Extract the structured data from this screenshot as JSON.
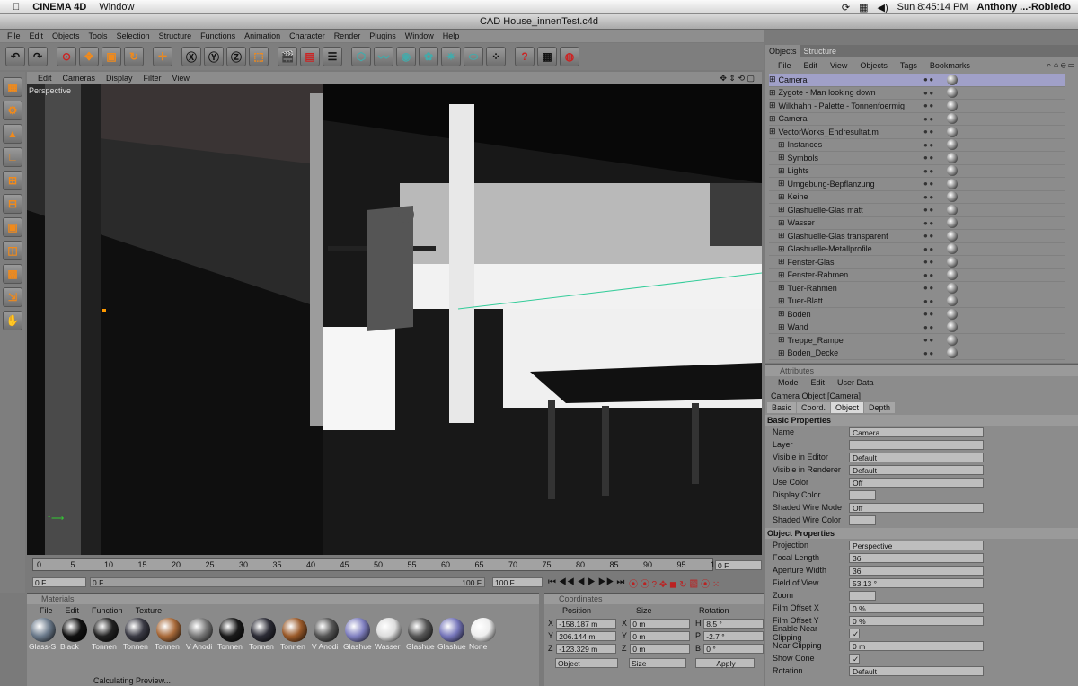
{
  "mac": {
    "app": "CINEMA 4D",
    "window": "Window",
    "clock": "Sun 8:45:14 PM",
    "user": "Anthony ...-Robledo"
  },
  "doc": {
    "title": "CAD House_innenTest.c4d"
  },
  "menu": [
    "File",
    "Edit",
    "Objects",
    "Tools",
    "Selection",
    "Structure",
    "Functions",
    "Animation",
    "Character",
    "Render",
    "Plugins",
    "Window",
    "Help"
  ],
  "viewport": {
    "menu": [
      "Edit",
      "Cameras",
      "Display",
      "Filter",
      "View"
    ],
    "label": "Perspective"
  },
  "timeline": {
    "ticks": [
      "0",
      "5",
      "10",
      "15",
      "20",
      "25",
      "30",
      "35",
      "40",
      "45",
      "50",
      "55",
      "60",
      "65",
      "70",
      "75",
      "80",
      "85",
      "90",
      "95",
      "100"
    ],
    "cur_frame": "0 F",
    "start": "0 F",
    "min": "0 F",
    "max": "100 F",
    "end": "100 F"
  },
  "materials": {
    "header": "Materials",
    "menu": [
      "File",
      "Edit",
      "Function",
      "Texture"
    ],
    "status": "Calculating Preview...",
    "items": [
      {
        "name": "Glass-S",
        "color": "#6c7b8c"
      },
      {
        "name": "Black",
        "color": "#111"
      },
      {
        "name": "Tonnen",
        "color": "#222"
      },
      {
        "name": "Tonnen",
        "color": "#3a3a44"
      },
      {
        "name": "Tonnen",
        "color": "#a86a3a"
      },
      {
        "name": "V Anodi",
        "color": "#777"
      },
      {
        "name": "Tonnen",
        "color": "#1a1a1a"
      },
      {
        "name": "Tonnen",
        "color": "#2c2c36"
      },
      {
        "name": "Tonnen",
        "color": "#9a5a2a"
      },
      {
        "name": "V Anodi",
        "color": "#555"
      },
      {
        "name": "Glashue",
        "color": "#8080c0"
      },
      {
        "name": "Wasser",
        "color": "#ddd"
      },
      {
        "name": "Glashue",
        "color": "#555"
      },
      {
        "name": "Glashue",
        "color": "#7777bb"
      },
      {
        "name": "None",
        "color": "#eee"
      }
    ]
  },
  "coords": {
    "header": "Coordinates",
    "cols": [
      "Position",
      "Size",
      "Rotation"
    ],
    "rows": [
      {
        "a": "X",
        "p": "-158.187 m",
        "b": "X",
        "s": "0 m",
        "c": "H",
        "r": "8.5 °"
      },
      {
        "a": "Y",
        "p": "206.144 m",
        "b": "Y",
        "s": "0 m",
        "c": "P",
        "r": "-2.7 °"
      },
      {
        "a": "Z",
        "p": "-123.329 m",
        "b": "Z",
        "s": "0 m",
        "c": "B",
        "r": "0 °"
      }
    ],
    "mode": "Object",
    "size": "Size",
    "apply": "Apply"
  },
  "objects": {
    "tabs": [
      "Objects",
      "Structure"
    ],
    "menu": [
      "File",
      "Edit",
      "View",
      "Objects",
      "Tags",
      "Bookmarks"
    ],
    "items": [
      {
        "name": "Camera",
        "indent": 0,
        "sel": true
      },
      {
        "name": "Zygote - Man looking down",
        "indent": 0
      },
      {
        "name": "Wilkhahn - Palette - Tonnenfoermig",
        "indent": 0
      },
      {
        "name": "Camera",
        "indent": 0
      },
      {
        "name": "VectorWorks_Endresultat.m",
        "indent": 0
      },
      {
        "name": "Instances",
        "indent": 1
      },
      {
        "name": "Symbols",
        "indent": 1
      },
      {
        "name": "Lights",
        "indent": 1
      },
      {
        "name": "Umgebung-Bepflanzung",
        "indent": 1
      },
      {
        "name": "Keine",
        "indent": 1
      },
      {
        "name": "Glashuelle-Glas matt",
        "indent": 1
      },
      {
        "name": "Wasser",
        "indent": 1
      },
      {
        "name": "Glashuelle-Glas transparent",
        "indent": 1
      },
      {
        "name": "Glashuelle-Metallprofile",
        "indent": 1
      },
      {
        "name": "Fenster-Glas",
        "indent": 1
      },
      {
        "name": "Fenster-Rahmen",
        "indent": 1
      },
      {
        "name": "Tuer-Rahmen",
        "indent": 1
      },
      {
        "name": "Tuer-Blatt",
        "indent": 1
      },
      {
        "name": "Boden",
        "indent": 1
      },
      {
        "name": "Wand",
        "indent": 1
      },
      {
        "name": "Treppe_Rampe",
        "indent": 1
      },
      {
        "name": "Boden_Decke",
        "indent": 1
      }
    ]
  },
  "attributes": {
    "header": "Attributes",
    "menu": [
      "Mode",
      "Edit",
      "User Data"
    ],
    "object": "Camera Object [Camera]",
    "tabs": [
      "Basic",
      "Coord.",
      "Object",
      "Depth"
    ],
    "basic_head": "Basic Properties",
    "basic": [
      {
        "l": "Name",
        "v": "Camera"
      },
      {
        "l": "Layer",
        "v": ""
      },
      {
        "l": "Visible in Editor",
        "v": "Default"
      },
      {
        "l": "Visible in Renderer",
        "v": "Default"
      },
      {
        "l": "Use Color",
        "v": "Off"
      },
      {
        "l": "Display Color",
        "v": ""
      },
      {
        "l": "Shaded Wire Mode",
        "v": "Off"
      },
      {
        "l": "Shaded Wire Color",
        "v": ""
      }
    ],
    "obj_head": "Object Properties",
    "obj": [
      {
        "l": "Projection",
        "v": "Perspective"
      },
      {
        "l": "Focal Length",
        "v": "36"
      },
      {
        "l": "Aperture Width",
        "v": "36"
      },
      {
        "l": "Field of View",
        "v": "53.13 °"
      },
      {
        "l": "Zoom",
        "v": ""
      },
      {
        "l": "Film Offset X",
        "v": "0 %"
      },
      {
        "l": "Film Offset Y",
        "v": "0 %"
      },
      {
        "l": "Enable Near Clipping",
        "v": "✓"
      },
      {
        "l": "Near Clipping",
        "v": "0 m"
      },
      {
        "l": "Show Cone",
        "v": "✓"
      },
      {
        "l": "Rotation",
        "v": "Default"
      }
    ]
  }
}
